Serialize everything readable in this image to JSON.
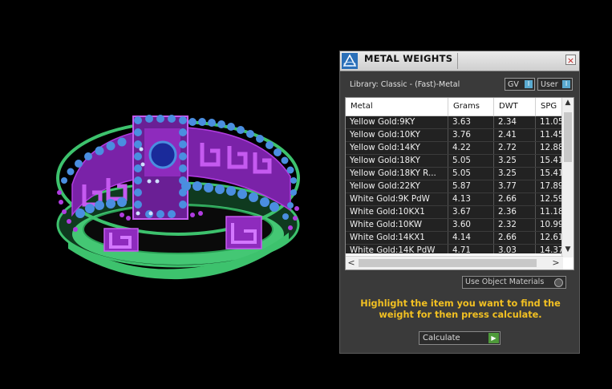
{
  "colors": {
    "background": "#000000",
    "ring_gold": "#3dc26d",
    "ring_purple": "#8e2bbd",
    "ring_gems": "#4a8ee0",
    "instruction_text": "#f2c022"
  },
  "window": {
    "title": "METAL WEIGHTS",
    "close_label": "×"
  },
  "library": {
    "label": "Library: Classic - (Fast)-Metal"
  },
  "toggles": [
    {
      "label": "GV",
      "indicator": "I"
    },
    {
      "label": "User",
      "indicator": "I"
    }
  ],
  "table": {
    "columns": [
      "Metal",
      "Grams",
      "DWT",
      "SPG"
    ],
    "rows": [
      {
        "metal": "Yellow Gold:9KY",
        "grams": "3.63",
        "dwt": "2.34",
        "spg": "11.05"
      },
      {
        "metal": "Yellow Gold:10KY",
        "grams": "3.76",
        "dwt": "2.41",
        "spg": "11.45"
      },
      {
        "metal": "Yellow Gold:14KY",
        "grams": "4.22",
        "dwt": "2.72",
        "spg": "12.88"
      },
      {
        "metal": "Yellow Gold:18KY",
        "grams": "5.05",
        "dwt": "3.25",
        "spg": "15.41"
      },
      {
        "metal": "Yellow Gold:18KY R...",
        "grams": "5.05",
        "dwt": "3.25",
        "spg": "15.41"
      },
      {
        "metal": "Yellow Gold:22KY",
        "grams": "5.87",
        "dwt": "3.77",
        "spg": "17.89"
      },
      {
        "metal": "White Gold:9K PdW",
        "grams": "4.13",
        "dwt": "2.66",
        "spg": "12.59"
      },
      {
        "metal": "White Gold:10KX1",
        "grams": "3.67",
        "dwt": "2.36",
        "spg": "11.18"
      },
      {
        "metal": "White Gold:10KW",
        "grams": "3.60",
        "dwt": "2.32",
        "spg": "10.99"
      },
      {
        "metal": "White Gold:14KX1",
        "grams": "4.14",
        "dwt": "2.66",
        "spg": "12.61"
      },
      {
        "metal": "White Gold:14K PdW",
        "grams": "4.71",
        "dwt": "3.03",
        "spg": "14.37"
      }
    ],
    "scroll_icons": {
      "up": "▲",
      "down": "▼",
      "left": "<",
      "right": ">"
    }
  },
  "use_object_materials": {
    "label": "Use Object Materials"
  },
  "instruction": {
    "text": "Highlight the item you want to find the weight for then press calculate."
  },
  "calculate": {
    "label": "Calculate",
    "icon": "▶"
  }
}
